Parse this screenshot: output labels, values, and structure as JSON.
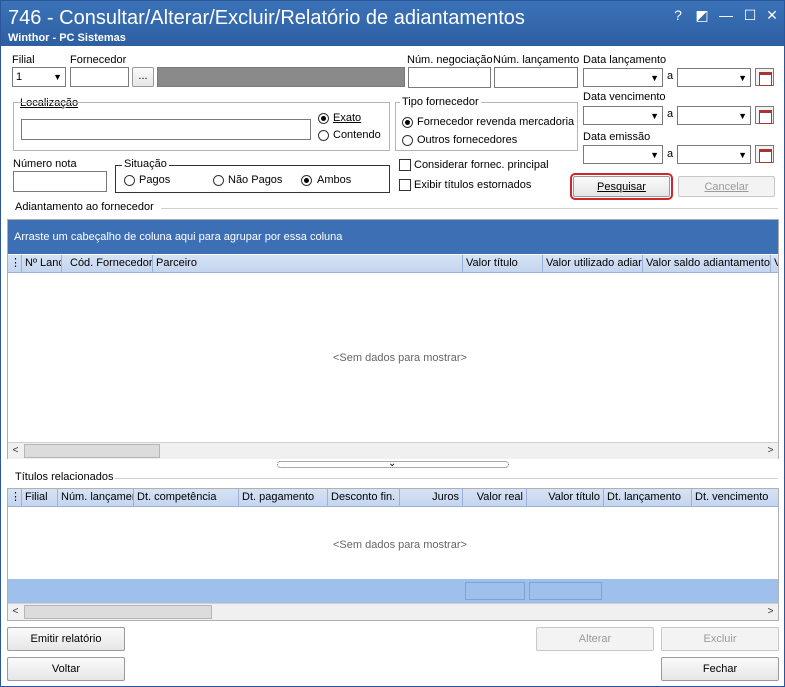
{
  "window": {
    "title": "746 - Consultar/Alterar/Excluir/Relatório de adiantamentos",
    "subtitle": "Winthor - PC Sistemas",
    "controls": [
      "?",
      "◩",
      "—",
      "☐",
      "✕"
    ]
  },
  "filters": {
    "filial_label": "Filial",
    "filial_value": "1",
    "fornecedor_label": "Fornecedor",
    "fornecedor_button": "...",
    "num_negociacao_label": "Núm. negociação",
    "num_lancamento_label": "Núm. lançamento",
    "data_lancamento_label": "Data lançamento",
    "data_vencimento_label": "Data vencimento",
    "data_emissao_label": "Data emissão",
    "ate_label": "a",
    "localizacao_label": "Localização",
    "exato_label": "Exato",
    "contendo_label": "Contendo",
    "tipo_fornecedor_label": "Tipo fornecedor",
    "tipo_opt1": "Fornecedor revenda mercadoria",
    "tipo_opt2": "Outros fornecedores",
    "numero_nota_label": "Número nota",
    "situacao_label": "Situação",
    "situacao_pagos": "Pagos",
    "situacao_nao_pagos": "Não Pagos",
    "situacao_ambos": "Ambos",
    "considerar_label": "Considerar fornec. principal",
    "exibir_label": "Exibir títulos estornados"
  },
  "buttons": {
    "pesquisar": "Pesquisar",
    "cancelar": "Cancelar",
    "emitir_relatorio": "Emitir relatório",
    "alterar": "Alterar",
    "excluir": "Excluir",
    "voltar": "Voltar",
    "fechar": "Fechar"
  },
  "grid1": {
    "section_title": "Adiantamento ao fornecedor",
    "group_hint": "Arraste um cabeçalho de coluna aqui para agrupar por essa coluna",
    "columns": [
      "Nº Lanc",
      "Cód. Fornecedor",
      "Parceiro",
      "Valor título",
      "Valor utilizado adiar",
      "Valor saldo adiantamento",
      "V"
    ],
    "empty_text": "<Sem dados para mostrar>"
  },
  "grid2": {
    "section_title": "Títulos relacionados",
    "columns": [
      "Filial",
      "Núm. lançamer",
      "Dt. competência",
      "Dt. pagamento",
      "Desconto fin.",
      "Juros",
      "Valor real",
      "Valor título",
      "Dt. lançamento",
      "Dt. vencimento"
    ],
    "empty_text": "<Sem dados para mostrar>"
  },
  "colors": {
    "title_bar": "#2d5fa1",
    "group_bar": "#3d6fb5",
    "focus_border": "#d0262b"
  }
}
